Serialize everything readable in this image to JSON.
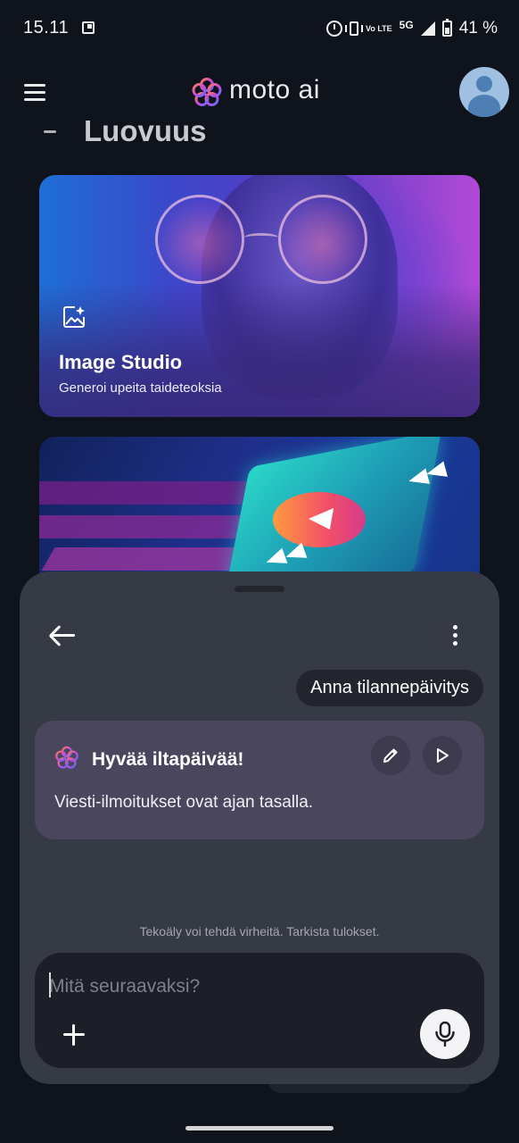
{
  "status_bar": {
    "time": "15.11",
    "network_volte": "Vo LTE",
    "network_type": "5G",
    "battery": "41 %"
  },
  "header": {
    "app_title": "moto ai"
  },
  "section": {
    "title": "Luovuus"
  },
  "cards": [
    {
      "title": "Image Studio",
      "subtitle": "Generoi upeita taideteoksia",
      "icon": "image-sparkle-icon"
    },
    {
      "icon": "video-icon"
    }
  ],
  "sheet": {
    "user_message": "Anna tilannepäivitys",
    "reply": {
      "title": "Hyvää iltapäivää!",
      "body": "Viesti-ilmoitukset ovat ajan tasalla."
    },
    "disclaimer": "Tekoäly voi tehdä virheitä. Tarkista tulokset.",
    "composer": {
      "placeholder": "Mitä seuraavaksi?",
      "value": ""
    }
  },
  "colors": {
    "background": "#0f131b",
    "sheet": "#363a45",
    "reply_card": "#4a465e",
    "composer": "#1c1f27",
    "brand_gradient": [
      "#ff7a5c",
      "#c84bd6",
      "#5b6cff"
    ]
  }
}
